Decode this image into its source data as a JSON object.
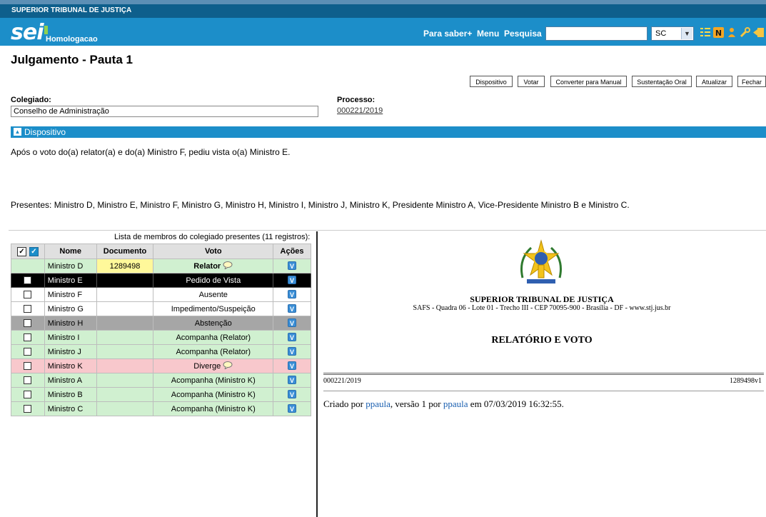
{
  "org_name": "SUPERIOR TRIBUNAL DE JUSTIÇA",
  "app": {
    "logo": "sei",
    "environment": "Homologacao"
  },
  "top_nav": {
    "links": [
      "Para saber+",
      "Menu",
      "Pesquisa"
    ],
    "search_value": "",
    "unit_selected": "SC"
  },
  "toolbar_icons": [
    "list-view-icon",
    "notes-icon",
    "user-icon",
    "tools-icon",
    "exit-icon"
  ],
  "page_title": "Julgamento - Pauta 1",
  "buttons": [
    "Dispositivo",
    "Votar",
    "Converter para Manual",
    "Sustentação Oral",
    "Atualizar",
    "Fechar"
  ],
  "colegiado": {
    "label": "Colegiado:",
    "value": "Conselho de Administração"
  },
  "processo": {
    "label": "Processo:",
    "value": "000221/2019"
  },
  "section_title": "Dispositivo",
  "dispositivo_text": "Após o voto do(a) relator(a) e do(a) Ministro F, pediu vista o(a) Ministro E.",
  "presentes_text": "Presentes: Ministro D, Ministro E, Ministro F, Ministro G, Ministro H, Ministro I, Ministro J,  Ministro K,  Presidente Ministro A, Vice-Presidente Ministro B e Ministro C.",
  "members_caption": "Lista de membros do colegiado presentes (11 registros):",
  "table_headers": [
    "Nome",
    "Documento",
    "Voto",
    "Ações"
  ],
  "members": [
    {
      "nome": "Ministro D",
      "documento": "1289498",
      "voto": "Relator",
      "row_style": "green"
    },
    {
      "nome": "Ministro E",
      "documento": "",
      "voto": "Pedido de Vista",
      "row_style": "black"
    },
    {
      "nome": "Ministro F",
      "documento": "",
      "voto": "Ausente",
      "row_style": "white"
    },
    {
      "nome": "Ministro G",
      "documento": "",
      "voto": "Impedimento/Suspeição",
      "row_style": "white"
    },
    {
      "nome": "Ministro H",
      "documento": "",
      "voto": "Abstenção",
      "row_style": "gray"
    },
    {
      "nome": "Ministro I",
      "documento": "",
      "voto": "Acompanha (Relator)",
      "row_style": "green"
    },
    {
      "nome": "Ministro J",
      "documento": "",
      "voto": "Acompanha (Relator)",
      "row_style": "green"
    },
    {
      "nome": "Ministro K",
      "documento": "",
      "voto": "Diverge",
      "row_style": "pink"
    },
    {
      "nome": "Ministro A",
      "documento": "",
      "voto": "Acompanha (Ministro K)",
      "row_style": "green"
    },
    {
      "nome": "Ministro B",
      "documento": "",
      "voto": "Acompanha (Ministro K)",
      "row_style": "green"
    },
    {
      "nome": "Ministro C",
      "documento": "",
      "voto": "Acompanha (Ministro K)",
      "row_style": "green"
    }
  ],
  "document": {
    "header_title": "SUPERIOR TRIBUNAL DE JUSTIÇA",
    "header_address": "SAFS - Quadra 06 - Lote 01 - Trecho III - CEP 70095-900 - Brasília - DF - www.stj.jus.br",
    "title": "RELATÓRIO E VOTO",
    "process_number": "000221/2019",
    "doc_version": "1289498v1",
    "created_prefix": "Criado por ",
    "created_user1": "ppaula",
    "created_middle": ", versão 1 por ",
    "created_user2": "ppaula",
    "created_suffix": " em 07/03/2019 16:32:55."
  },
  "colors": {
    "header_blue": "#1c8ec9",
    "org_bar": "#0e5f8c",
    "row_green": "#d0f0d0",
    "row_pink": "#f8c8cc",
    "row_gray": "#a6a6a6",
    "doc_yellow": "#fff89a"
  }
}
